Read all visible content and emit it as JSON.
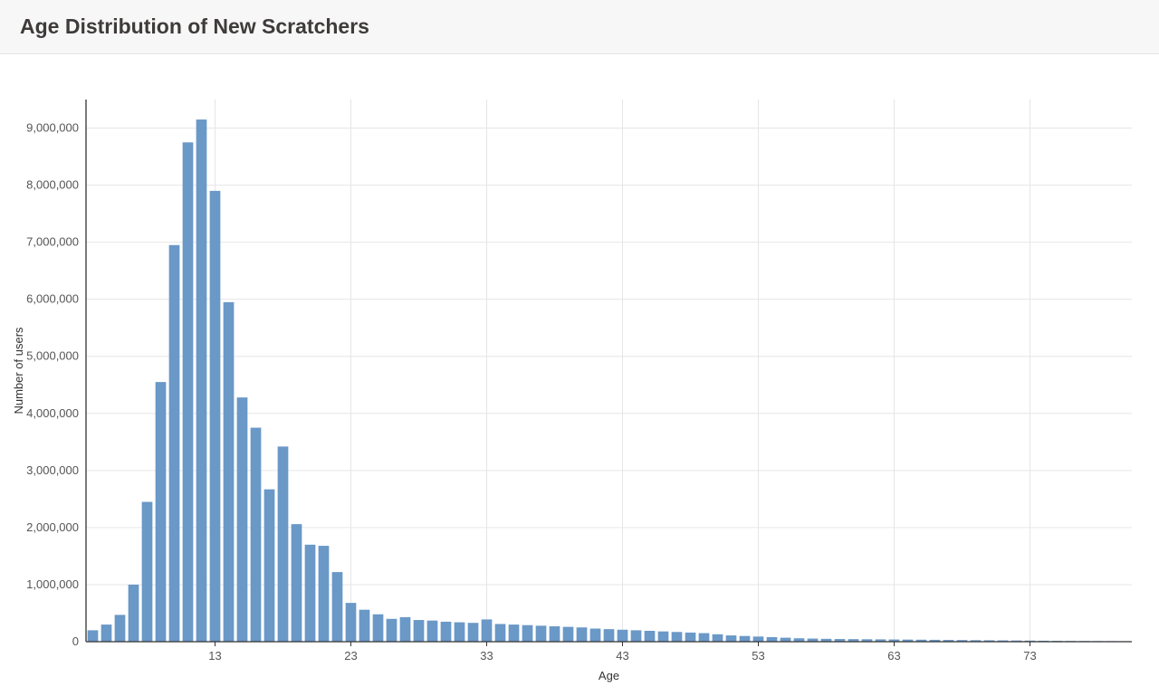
{
  "header": {
    "title": "Age Distribution of New Scratchers"
  },
  "chart_data": {
    "type": "bar",
    "title": "Age Distribution of New Scratchers",
    "xlabel": "Age",
    "ylabel": "Number of users",
    "categories": [
      4,
      5,
      6,
      7,
      8,
      9,
      10,
      11,
      12,
      13,
      14,
      15,
      16,
      17,
      18,
      19,
      20,
      21,
      22,
      23,
      24,
      25,
      26,
      27,
      28,
      29,
      30,
      31,
      32,
      33,
      34,
      35,
      36,
      37,
      38,
      39,
      40,
      41,
      42,
      43,
      44,
      45,
      46,
      47,
      48,
      49,
      50,
      51,
      52,
      53,
      54,
      55,
      56,
      57,
      58,
      59,
      60,
      61,
      62,
      63,
      64,
      65,
      66,
      67,
      68,
      69,
      70,
      71,
      72,
      73,
      74,
      75,
      76,
      77,
      78,
      79,
      80
    ],
    "values": [
      200000,
      300000,
      470000,
      1000000,
      2450000,
      4550000,
      6950000,
      8750000,
      9150000,
      7900000,
      5950000,
      4280000,
      3750000,
      2670000,
      3420000,
      2060000,
      1700000,
      1680000,
      1220000,
      680000,
      560000,
      480000,
      400000,
      430000,
      380000,
      370000,
      350000,
      340000,
      330000,
      390000,
      310000,
      300000,
      290000,
      280000,
      270000,
      260000,
      250000,
      230000,
      220000,
      210000,
      200000,
      190000,
      180000,
      170000,
      160000,
      150000,
      130000,
      110000,
      100000,
      90000,
      80000,
      70000,
      60000,
      55000,
      50000,
      47000,
      45000,
      43000,
      41000,
      39000,
      37000,
      35000,
      33000,
      31000,
      29000,
      27000,
      25000,
      23000,
      21000,
      19000,
      17000,
      15000,
      13000,
      12000,
      11000,
      10000,
      9000
    ],
    "x_ticks": [
      13,
      23,
      33,
      43,
      53,
      63,
      73
    ],
    "y_ticks": [
      0,
      1000000,
      2000000,
      3000000,
      4000000,
      5000000,
      6000000,
      7000000,
      8000000,
      9000000
    ],
    "ylim": [
      0,
      9500000
    ],
    "bar_color": "#6a98c7"
  }
}
